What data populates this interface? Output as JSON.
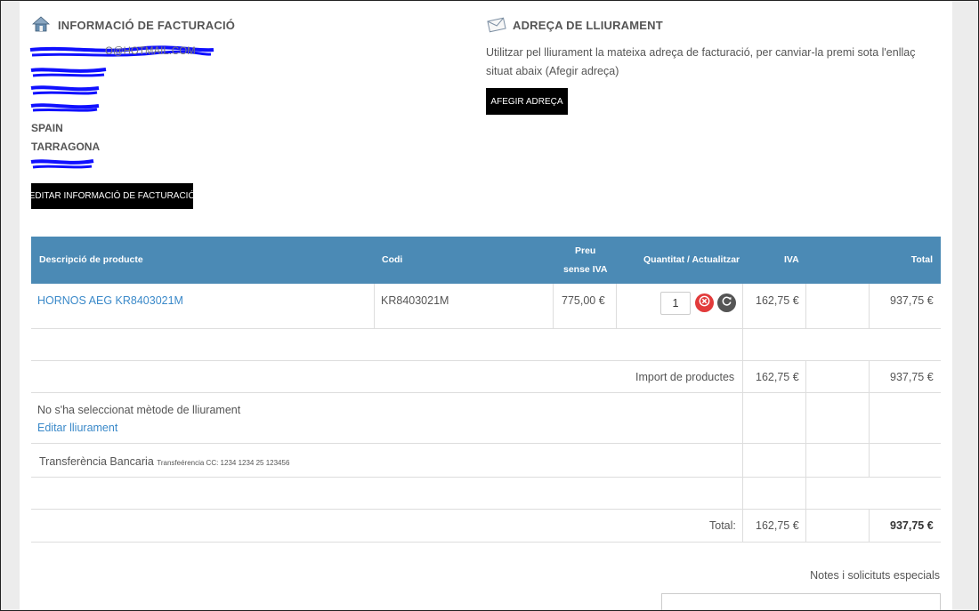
{
  "billing": {
    "title": "INFORMACIÓ DE FACTURACIÓ",
    "email_visible": "O@HOTMAIL.COM",
    "country": "SPAIN",
    "province": "TARRAGONA",
    "edit_button": "EDITAR INFORMACIÓ DE FACTURACIÓ",
    "icon": "home-icon"
  },
  "shipping": {
    "title": "ADREÇA DE LLIURAMENT",
    "text": "Utilitzar pel lliurament la mateixa adreça de facturació, per canviar-la premi sota l'enllaç situat abaix (Afegir adreça)",
    "add_button": "AFEGIR ADREÇA",
    "icon": "envelope-icon"
  },
  "cart": {
    "columns": {
      "description": "Descripció de producte",
      "code": "Codi",
      "price_line1": "Preu",
      "price_line2": "sense IVA",
      "quantity": "Quantitat / Actualitzar",
      "vat": "IVA",
      "total": "Total"
    },
    "header_color": "#4b8ab5",
    "items": [
      {
        "name": "HORNOS AEG KR8403021M",
        "code": "KR8403021M",
        "price": "775,00 €",
        "quantity": "1",
        "vat": "162,75 €",
        "total": "937,75 €"
      }
    ],
    "products_import": {
      "label": "Import de productes",
      "vat": "162,75 €",
      "total": "937,75 €"
    },
    "shipping_method": {
      "text": "No s'ha seleccionat mètode de lliurament",
      "link": "Editar lliurament"
    },
    "payment": {
      "name": "Transferència Bancaria",
      "detail": "Transfeérencia CC: 1234 1234 25 123456"
    },
    "grand_total": {
      "label": "Total:",
      "vat": "162,75 €",
      "total": "937,75 €"
    }
  },
  "notes": {
    "label": "Notes i solicituts especials"
  }
}
